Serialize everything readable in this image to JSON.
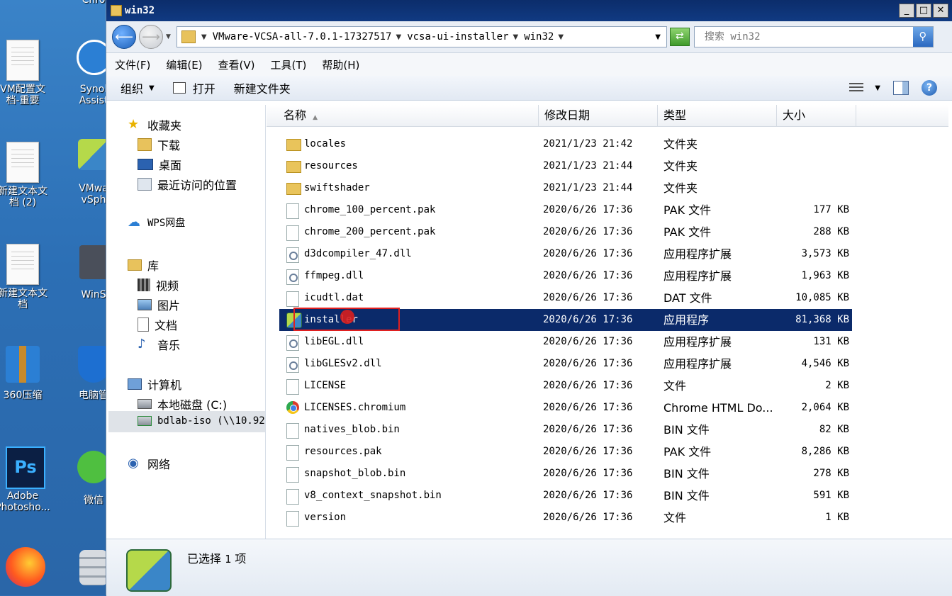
{
  "desktop": {
    "icons": [
      {
        "label": "VM配置文档-重要"
      },
      {
        "label": "Synol Assist"
      },
      {
        "label": "新建文本文档 (2)"
      },
      {
        "label": "VMwa vSph"
      },
      {
        "label": "新建文本文档"
      },
      {
        "label": "WinS"
      },
      {
        "label": "360压缩"
      },
      {
        "label": "电脑管"
      },
      {
        "label": "Adobe Photosho..."
      },
      {
        "label": "微信"
      },
      {
        "label": "Chro"
      }
    ]
  },
  "window": {
    "title": "win32",
    "minimize": "_",
    "maximize": "□",
    "close": "✕"
  },
  "address": {
    "crumbs": [
      "VMware-VCSA-all-7.0.1-17327517",
      "vcsa-ui-installer",
      "win32"
    ],
    "search_placeholder": "搜索 win32"
  },
  "menu": [
    "文件(F)",
    "编辑(E)",
    "查看(V)",
    "工具(T)",
    "帮助(H)"
  ],
  "toolbar": {
    "organize": "组织",
    "open": "打开",
    "new_folder": "新建文件夹"
  },
  "nav": {
    "favorites": "收藏夹",
    "downloads": "下载",
    "desktop": "桌面",
    "recent": "最近访问的位置",
    "wps": "WPS网盘",
    "library": "库",
    "videos": "视频",
    "pictures": "图片",
    "documents": "文档",
    "music": "音乐",
    "computer": "计算机",
    "local_disk": "本地磁盘 (C:)",
    "network_drive": "bdlab-iso (\\\\10.92",
    "network": "网络"
  },
  "columns": {
    "name": "名称",
    "date": "修改日期",
    "type": "类型",
    "size": "大小"
  },
  "files": [
    {
      "name": "locales",
      "date": "2021/1/23 21:42",
      "type": "文件夹",
      "size": "",
      "icon": "folder"
    },
    {
      "name": "resources",
      "date": "2021/1/23 21:44",
      "type": "文件夹",
      "size": "",
      "icon": "folder"
    },
    {
      "name": "swiftshader",
      "date": "2021/1/23 21:44",
      "type": "文件夹",
      "size": "",
      "icon": "folder"
    },
    {
      "name": "chrome_100_percent.pak",
      "date": "2020/6/26 17:36",
      "type": "PAK 文件",
      "size": "177 KB",
      "icon": "file"
    },
    {
      "name": "chrome_200_percent.pak",
      "date": "2020/6/26 17:36",
      "type": "PAK 文件",
      "size": "288 KB",
      "icon": "file"
    },
    {
      "name": "d3dcompiler_47.dll",
      "date": "2020/6/26 17:36",
      "type": "应用程序扩展",
      "size": "3,573 KB",
      "icon": "dll"
    },
    {
      "name": "ffmpeg.dll",
      "date": "2020/6/26 17:36",
      "type": "应用程序扩展",
      "size": "1,963 KB",
      "icon": "dll"
    },
    {
      "name": "icudtl.dat",
      "date": "2020/6/26 17:36",
      "type": "DAT 文件",
      "size": "10,085 KB",
      "icon": "file"
    },
    {
      "name": "installer",
      "date": "2020/6/26 17:36",
      "type": "应用程序",
      "size": "81,368 KB",
      "icon": "app",
      "selected": true
    },
    {
      "name": "libEGL.dll",
      "date": "2020/6/26 17:36",
      "type": "应用程序扩展",
      "size": "131 KB",
      "icon": "dll"
    },
    {
      "name": "libGLESv2.dll",
      "date": "2020/6/26 17:36",
      "type": "应用程序扩展",
      "size": "4,546 KB",
      "icon": "dll"
    },
    {
      "name": "LICENSE",
      "date": "2020/6/26 17:36",
      "type": "文件",
      "size": "2 KB",
      "icon": "file"
    },
    {
      "name": "LICENSES.chromium",
      "date": "2020/6/26 17:36",
      "type": "Chrome HTML Do...",
      "size": "2,064 KB",
      "icon": "chrome"
    },
    {
      "name": "natives_blob.bin",
      "date": "2020/6/26 17:36",
      "type": "BIN 文件",
      "size": "82 KB",
      "icon": "file"
    },
    {
      "name": "resources.pak",
      "date": "2020/6/26 17:36",
      "type": "PAK 文件",
      "size": "8,286 KB",
      "icon": "file"
    },
    {
      "name": "snapshot_blob.bin",
      "date": "2020/6/26 17:36",
      "type": "BIN 文件",
      "size": "278 KB",
      "icon": "file"
    },
    {
      "name": "v8_context_snapshot.bin",
      "date": "2020/6/26 17:36",
      "type": "BIN 文件",
      "size": "591 KB",
      "icon": "file"
    },
    {
      "name": "version",
      "date": "2020/6/26 17:36",
      "type": "文件",
      "size": "1 KB",
      "icon": "file"
    }
  ],
  "status": {
    "prefix": "已选择",
    "count": "1",
    "suffix": "项"
  }
}
